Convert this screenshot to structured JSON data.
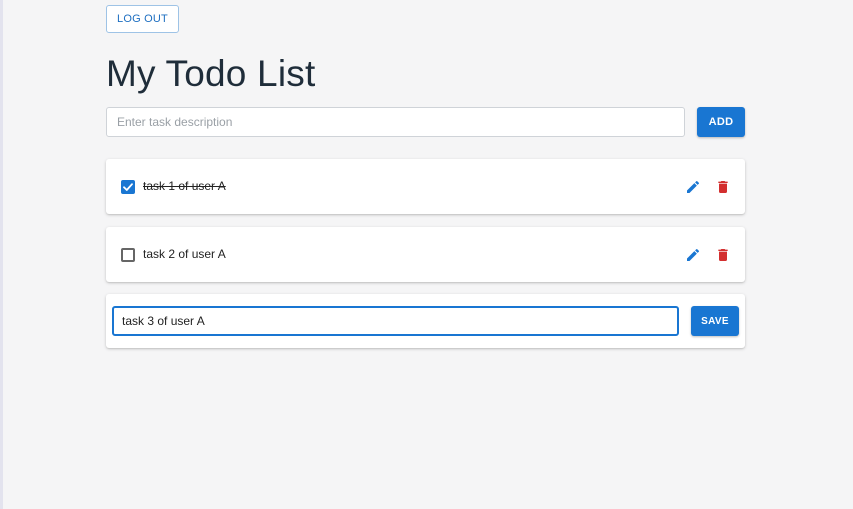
{
  "colors": {
    "accent": "#1976d2",
    "danger": "#d32f2f",
    "background": "#f5f5f6",
    "card": "#ffffff"
  },
  "header": {
    "logout_label": "LOG OUT",
    "title": "My Todo List"
  },
  "add_form": {
    "placeholder": "Enter task description",
    "value": "",
    "add_label": "ADD"
  },
  "todos": [
    {
      "text": "task 1 of user A",
      "completed": true,
      "edit_icon": "pencil-icon",
      "delete_icon": "trash-icon"
    },
    {
      "text": "task 2 of user A",
      "completed": false,
      "edit_icon": "pencil-icon",
      "delete_icon": "trash-icon"
    }
  ],
  "editing": {
    "value": "task 3 of user A",
    "save_label": "SAVE"
  }
}
